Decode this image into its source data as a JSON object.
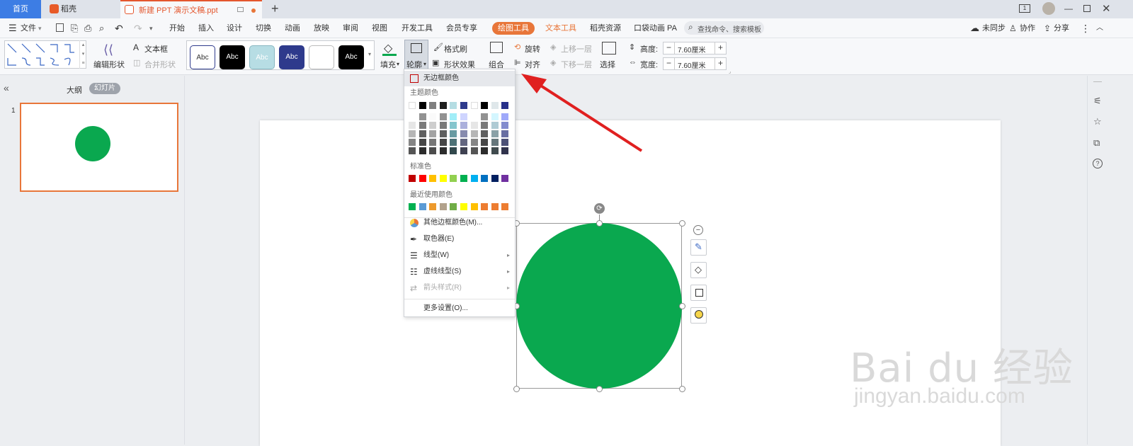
{
  "tabs": {
    "home": "首页",
    "daoke": "稻壳",
    "doc": "新建 PPT 演示文稿.ppt"
  },
  "menubar": {
    "file": "文件",
    "items": [
      "开始",
      "插入",
      "设计",
      "切换",
      "动画",
      "放映",
      "审阅",
      "视图",
      "开发工具",
      "会员专享"
    ],
    "drawing_tools": "绘图工具",
    "text_tools": "文本工具",
    "daoke_resources": "稻壳资源",
    "pocket_anim": "口袋动画 PA",
    "search_placeholder": "查找命令、搜索模板",
    "unsynced": "未同步",
    "collab": "协作",
    "share": "分享"
  },
  "ribbon": {
    "edit_shape": "编辑形状",
    "text_box": "文本框",
    "merge_shape": "合并形状",
    "style_sample": "Abc",
    "fill": "填充",
    "outline": "轮廓",
    "format_painter": "格式刷",
    "shape_effect": "形状效果",
    "group": "组合",
    "rotate": "旋转",
    "align": "对齐",
    "bring_forward": "上移一层",
    "send_backward": "下移一层",
    "select": "选择",
    "height_label": "高度:",
    "height_value": "7.60厘米",
    "width_label": "宽度:",
    "width_value": "7.60厘米"
  },
  "left_panel": {
    "outline_tab": "大纲",
    "slides_tab": "幻灯片",
    "slide_number": "1"
  },
  "dropdown": {
    "no_border": "无边框颜色",
    "theme_colors": "主题颜色",
    "standard_colors": "标准色",
    "recent_colors": "最近使用颜色",
    "more_border_colors": "其他边框颜色(M)...",
    "eyedropper": "取色器(E)",
    "line_style": "线型(W)",
    "dash_style": "虚线线型(S)",
    "arrow_style": "箭头样式(R)",
    "more_settings": "更多设置(O)..."
  },
  "colors": {
    "shape_fill": "#0aa84f",
    "accent": "#e8763a",
    "arrow": "#e02020",
    "theme_row": [
      "#ffffff",
      "#000000",
      "#7f7f7f",
      "#1f1f1f",
      "#b5dde3",
      "#2e3a8c",
      "#ffffff",
      "#000000",
      "#dfe7ea",
      "#27308a"
    ],
    "standard": [
      "#c00000",
      "#ff0000",
      "#ffc000",
      "#ffff00",
      "#92d050",
      "#00b050",
      "#00b0f0",
      "#0070c0",
      "#002060",
      "#7030a0"
    ],
    "recent": [
      "#00b050",
      "#5b9bd5",
      "#ed9a2c",
      "#b2a28c",
      "#70ad47",
      "#ffff00",
      "#ffc000",
      "#ed7d31",
      "#ed7d31",
      "#ed7d31"
    ]
  },
  "watermark": {
    "brand": "Bai du 经验",
    "url": "jingyan.baidu.com"
  }
}
